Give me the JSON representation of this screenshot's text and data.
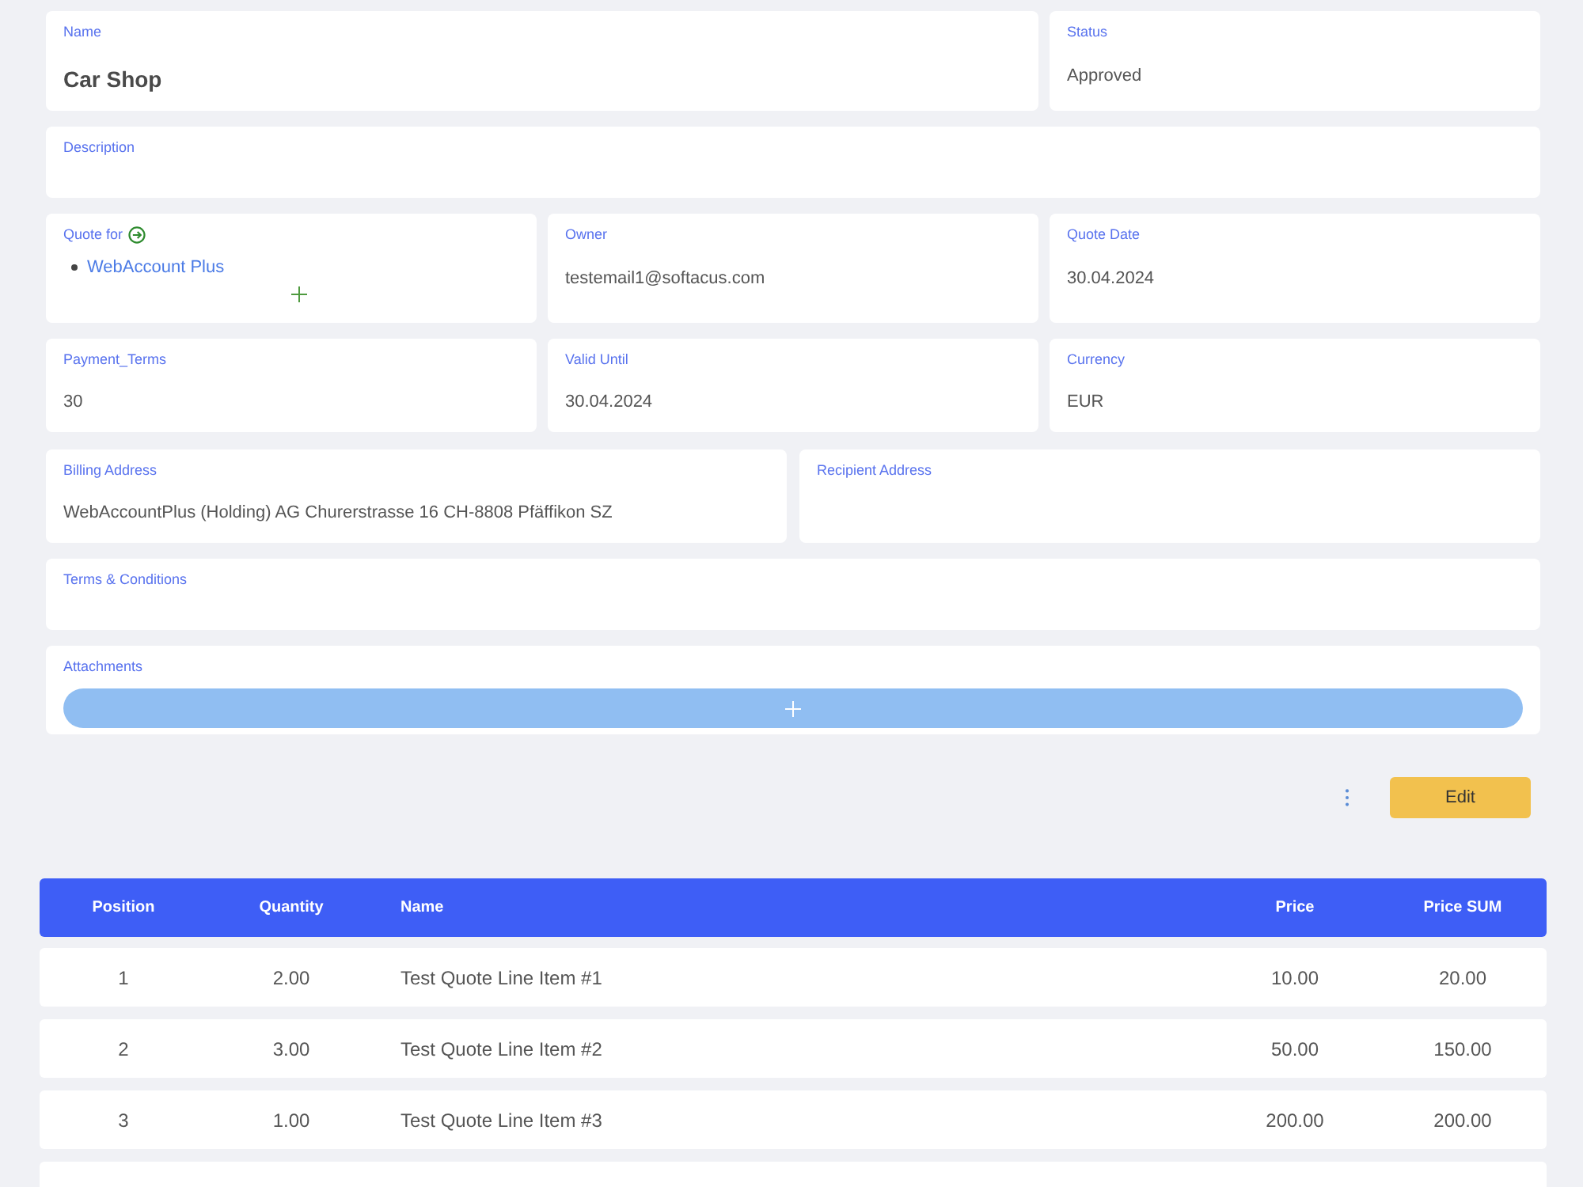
{
  "name": {
    "label": "Name",
    "value": "Car Shop"
  },
  "status": {
    "label": "Status",
    "value": "Approved"
  },
  "description": {
    "label": "Description"
  },
  "quote_for": {
    "label": "Quote for",
    "items": [
      "WebAccount Plus"
    ]
  },
  "owner": {
    "label": "Owner",
    "value": "testemail1@softacus.com"
  },
  "quote_date": {
    "label": "Quote Date",
    "value": "30.04.2024"
  },
  "payment_terms": {
    "label": "Payment_Terms",
    "value": "30"
  },
  "valid_until": {
    "label": "Valid Until",
    "value": "30.04.2024"
  },
  "currency": {
    "label": "Currency",
    "value": "EUR"
  },
  "billing_address": {
    "label": "Billing Address",
    "value": "WebAccountPlus (Holding) AG Churerstrasse 16 CH-8808 Pfäffikon SZ"
  },
  "recipient_address": {
    "label": "Recipient Address"
  },
  "terms": {
    "label": "Terms & Conditions"
  },
  "attachments": {
    "label": "Attachments"
  },
  "actions": {
    "edit": "Edit"
  },
  "table": {
    "columns": [
      "Position",
      "Quantity",
      "Name",
      "Price",
      "Price SUM"
    ],
    "rows": [
      [
        "1",
        "2.00",
        "Test Quote Line Item #1",
        "10.00",
        "20.00"
      ],
      [
        "2",
        "3.00",
        "Test Quote Line Item #2",
        "50.00",
        "150.00"
      ],
      [
        "3",
        "1.00",
        "Test Quote Line Item #3",
        "200.00",
        "200.00"
      ]
    ],
    "cut_off_row": true
  }
}
